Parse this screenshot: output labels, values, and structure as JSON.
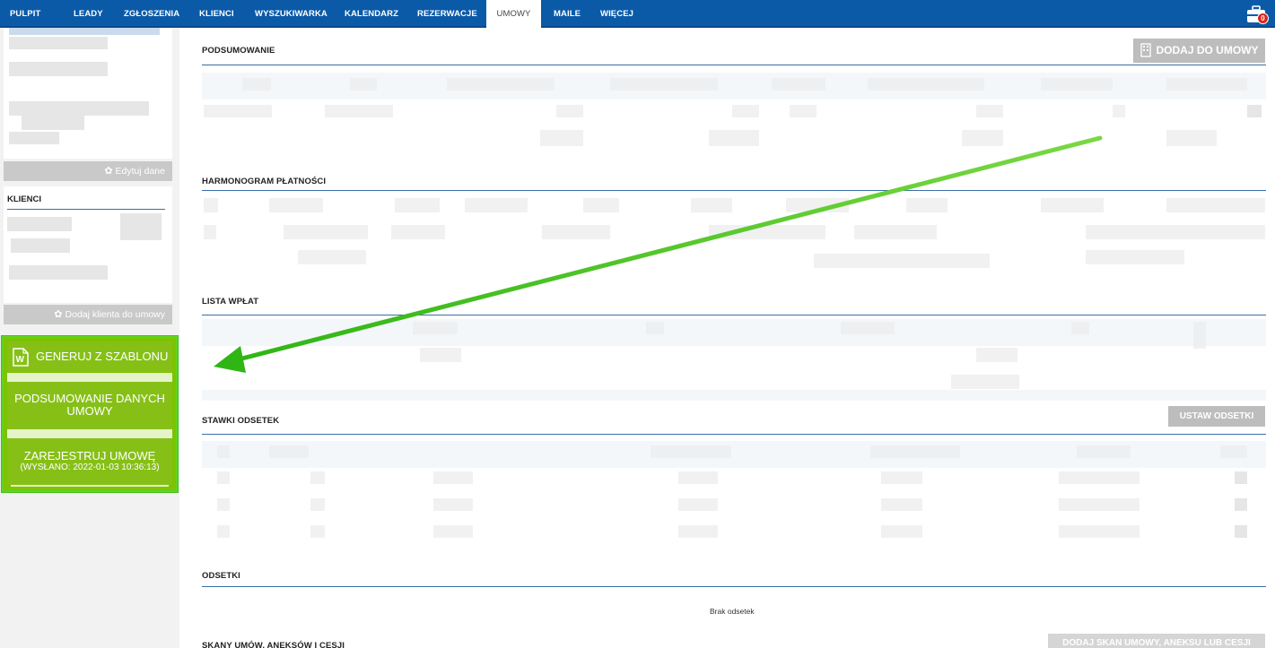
{
  "nav": {
    "items": [
      {
        "label": "PULPIT"
      },
      {
        "label": "LEADY"
      },
      {
        "label": "ZGŁOSZENIA"
      },
      {
        "label": "KLIENCI"
      },
      {
        "label": "WYSZUKIWARKA"
      },
      {
        "label": "KALENDARZ"
      },
      {
        "label": "REZERWACJE"
      },
      {
        "label": "UMOWY",
        "active": true
      },
      {
        "label": "MAILE"
      },
      {
        "label": "WIĘCEJ"
      }
    ],
    "toolbox_badge": "0"
  },
  "sidebar": {
    "edit_button": "Edytuj dane",
    "clients_heading": "KLIENCI",
    "add_client_button": "Dodaj klienta do umowy",
    "generate_button": "GENERUJ Z SZABLONU",
    "summary_button": "PODSUMOWANIE DANYCH UMOWY",
    "register_button": "ZAREJESTRUJ UMOWĘ",
    "register_sent": "(WYSŁANO: 2022-01-03 10:36:13)"
  },
  "main": {
    "summary_title": "PODSUMOWANIE",
    "add_to_contract_button": "DODAJ DO UMOWY",
    "schedule_title": "HARMONOGRAM PŁATNOŚCI",
    "payments_title": "LISTA WPŁAT",
    "rates_title": "STAWKI ODSETEK",
    "set_interest_button": "USTAW ODSETKI",
    "interest_title": "ODSETKI",
    "no_interest": "Brak odsetek",
    "scans_title": "SKANY UMÓW, ANEKSÓW I CESJI",
    "add_scan_button": "DODAJ SKAN UMOWY, ANEKSU LUB CESJI"
  },
  "colors": {
    "nav_bg": "#0b5aa7",
    "accent_green": "#7cc300",
    "arrow_green": "#4cc81f",
    "section_rule": "#3a6ea5"
  },
  "icons": [
    "gear-icon",
    "word-document-icon",
    "toolbox-icon",
    "building-icon"
  ]
}
